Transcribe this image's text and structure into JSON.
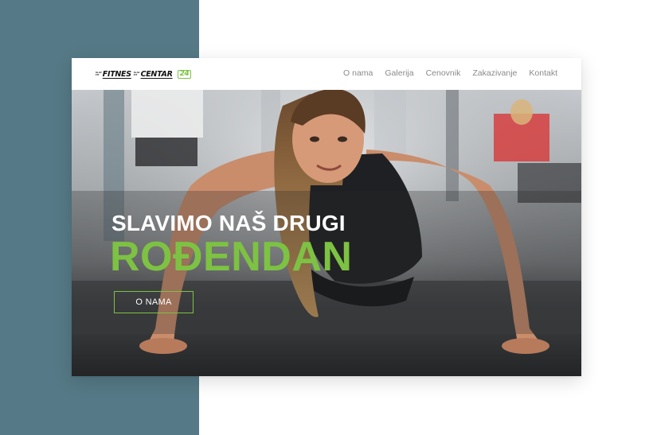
{
  "logo": {
    "tiny_top_1": "SLAV",
    "tiny_top_2": "FIT",
    "word1": "FITNES",
    "tiny_mid_1": "SLAV",
    "tiny_mid_2": "FIT",
    "word2": "CENTAR",
    "number": "24"
  },
  "nav": {
    "items": [
      {
        "label": "O nama"
      },
      {
        "label": "Galerija"
      },
      {
        "label": "Cenovnik"
      },
      {
        "label": "Zakazivanje"
      },
      {
        "label": "Kontakt"
      }
    ]
  },
  "hero": {
    "headline": "SLAVIMO NAŠ DRUGI",
    "headline_highlight": "ROĐENDAN",
    "button_label": "O NAMA"
  },
  "colors": {
    "accent": "#7dc242",
    "side_panel": "#557986",
    "nav_text": "#8a8a8a"
  },
  "icons": [
    "hero-photo-image"
  ]
}
